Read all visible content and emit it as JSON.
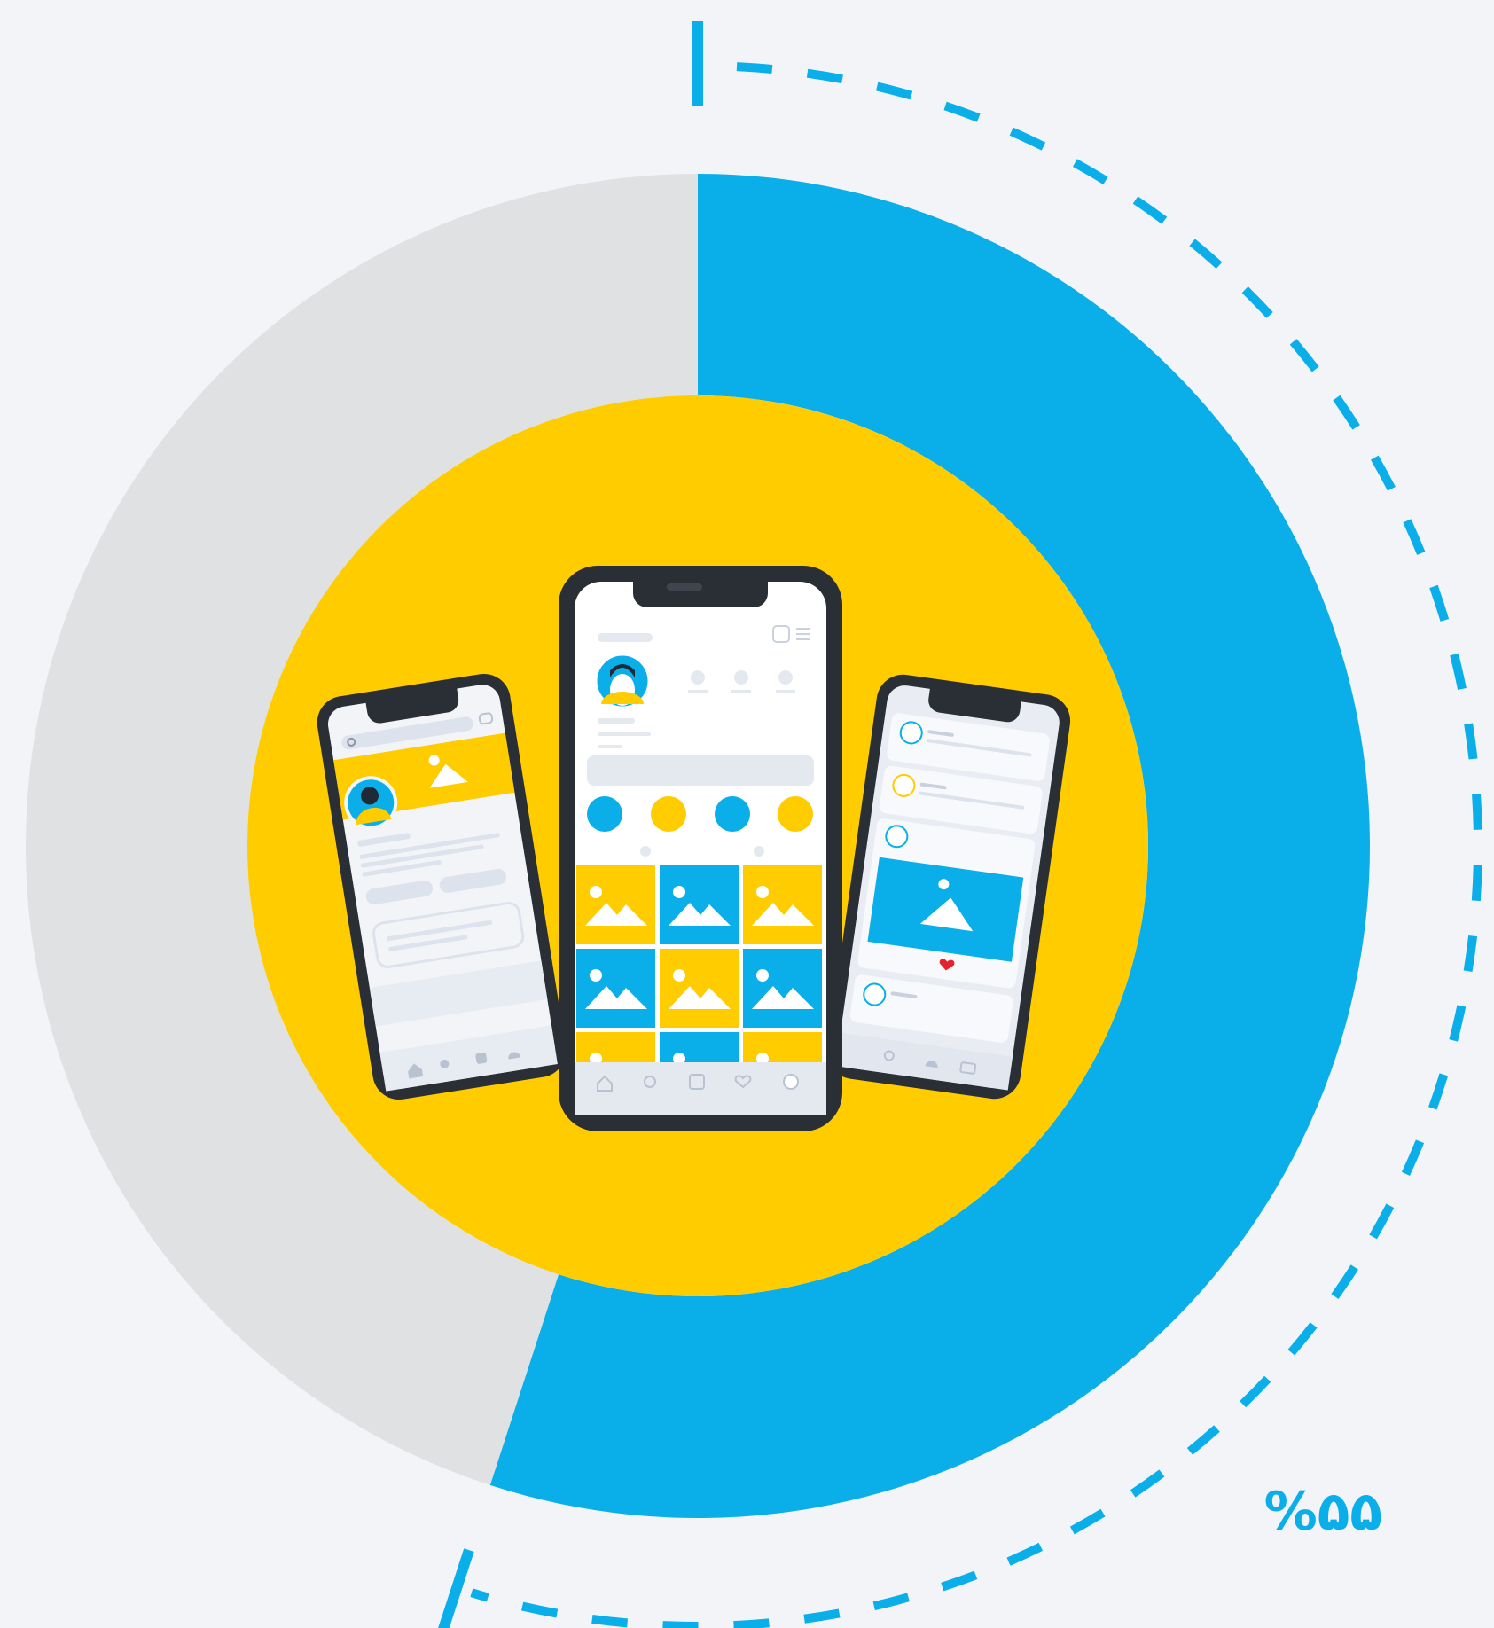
{
  "chart_data": {
    "type": "pie",
    "slices": [
      {
        "value": 55
      },
      {
        "value": 45
      }
    ],
    "label": "%۵۵"
  },
  "colors": {
    "background": "#f3f4f8",
    "accent": "#0aaee9",
    "remainder": "#e0e1e3",
    "center": "#ffcc00",
    "phone_frame": "#2a2e35",
    "screen": "#f3f4f8",
    "placeholder": "#dde3ec",
    "heart": "#e8212e"
  },
  "icons": [
    "search-icon",
    "chat-icon",
    "home-icon",
    "add-icon",
    "heart-icon",
    "bell-icon",
    "mail-icon",
    "image-icon",
    "avatar-icon"
  ]
}
